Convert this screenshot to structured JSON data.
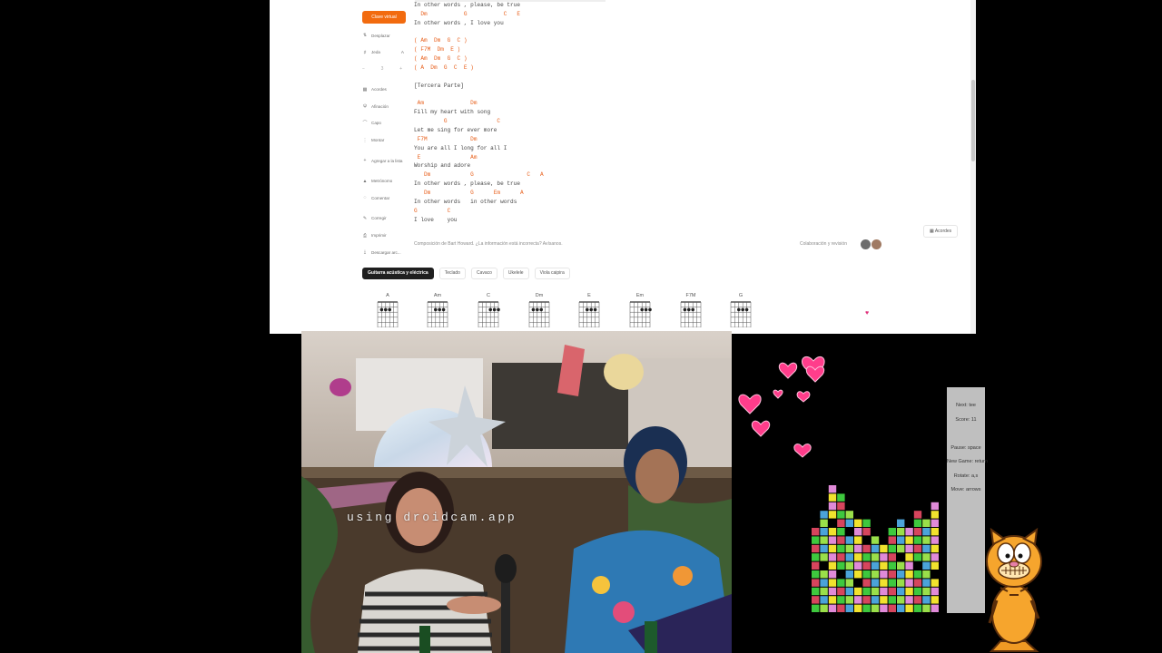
{
  "sidebar": {
    "virtual_key": "Clave virtual",
    "scroll": "Desplazar",
    "key": "Jeda",
    "key_value": "A",
    "size_minus": "−",
    "size_sep": "3",
    "size_plus": "+",
    "chords": "Acordes",
    "afinacion": "Afinación",
    "capo": "Capo",
    "montar": "Montar",
    "add_list": "Agregar a la lista",
    "metronome": "Metrónomo",
    "comments": "Comentar",
    "correct": "Corregir",
    "print": "Imprimir",
    "download": "Descargar arc..."
  },
  "song_lines": [
    {
      "type": "lyric",
      "text": "In other words , please, be true"
    },
    {
      "type": "chord",
      "text": "  Dm           G           C   E"
    },
    {
      "type": "lyric",
      "text": "In other words , I love you"
    },
    {
      "type": "blank",
      "text": ""
    },
    {
      "type": "chord",
      "text": "( Am  Dm  G  C )"
    },
    {
      "type": "chord",
      "text": "( F7M  Dm  E )"
    },
    {
      "type": "chord",
      "text": "( Am  Dm  G  C )"
    },
    {
      "type": "chord",
      "text": "( A  Dm  G  C  E )"
    },
    {
      "type": "blank",
      "text": ""
    },
    {
      "type": "lyric",
      "text": "[Tercera Parte]"
    },
    {
      "type": "blank",
      "text": ""
    },
    {
      "type": "chord",
      "text": " Am              Dm"
    },
    {
      "type": "lyric",
      "text": "Fill my heart with song"
    },
    {
      "type": "chord",
      "text": "         G               C"
    },
    {
      "type": "lyric",
      "text": "Let me sing for ever more"
    },
    {
      "type": "chord",
      "text": " F7M             Dm"
    },
    {
      "type": "lyric",
      "text": "You are all I long for all I"
    },
    {
      "type": "chord",
      "text": " E               Am"
    },
    {
      "type": "lyric",
      "text": "Worship and adore"
    },
    {
      "type": "chord",
      "text": "   Dm            G                C   A"
    },
    {
      "type": "lyric",
      "text": "In other words , please, be true"
    },
    {
      "type": "chord",
      "text": "   Dm            G      Em      A"
    },
    {
      "type": "lyric",
      "text": "In other words   in other words"
    },
    {
      "type": "chord",
      "text": "G         C"
    },
    {
      "type": "lyric",
      "text": "I love    you"
    }
  ],
  "credit": "Composición de Bart Howard. ¿La información está incorrecta? Avísanos.",
  "collab": "Colaboración y revisión",
  "acordes_button": "Acordes",
  "instrument_tabs": [
    {
      "label": "Guitarra acústica y eléctrica",
      "active": true
    },
    {
      "label": "Teclado",
      "active": false
    },
    {
      "label": "Cavaco",
      "active": false
    },
    {
      "label": "Ukelele",
      "active": false
    },
    {
      "label": "Viola caipira",
      "active": false
    }
  ],
  "chord_diagrams": [
    "A",
    "Am",
    "C",
    "Dm",
    "E",
    "Em",
    "F7M",
    "G"
  ],
  "webcam": {
    "watermark": "using droidcam.app"
  },
  "tetris": {
    "next": "Next: tee",
    "score": "Score: 11",
    "pause": "Pause: space",
    "new_game": "New Game: return",
    "rotate": "Rotate: a,s",
    "move": "Move: arrows"
  },
  "colors": {
    "accent": "#f26b0f",
    "chord_color": "#e8601c",
    "heart": "#ff3d8b"
  }
}
